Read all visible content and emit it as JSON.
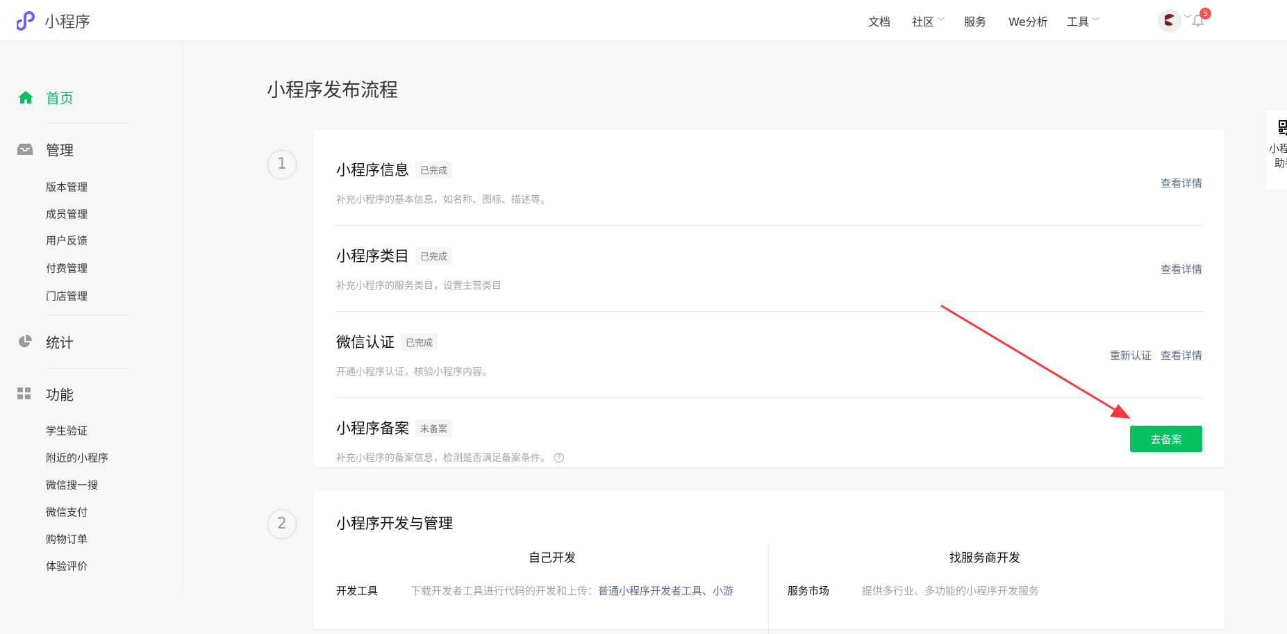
{
  "header": {
    "app_name": "小程序",
    "nav": [
      {
        "label": "文档"
      },
      {
        "label": "社区",
        "dropdown": true
      },
      {
        "label": "服务"
      },
      {
        "label": "We分析"
      },
      {
        "label": "工具",
        "dropdown": true
      }
    ],
    "notification_count": "5"
  },
  "sidebar": {
    "home": "首页",
    "manage": {
      "label": "管理",
      "items": [
        "版本管理",
        "成员管理",
        "用户反馈",
        "付费管理",
        "门店管理"
      ]
    },
    "stats": "统计",
    "features": {
      "label": "功能",
      "items": [
        "学生验证",
        "附近的小程序",
        "微信搜一搜",
        "微信支付",
        "购物订单",
        "体验评价"
      ]
    }
  },
  "main": {
    "title": "小程序发布流程",
    "step1": {
      "number": "1",
      "items": [
        {
          "title": "小程序信息",
          "status": "已完成",
          "desc": "补充小程序的基本信息，如名称、图标、描述等。",
          "links": [
            "查看详情"
          ]
        },
        {
          "title": "小程序类目",
          "status": "已完成",
          "desc": "补充小程序的服务类目，设置主营类目",
          "links": [
            "查看详情"
          ]
        },
        {
          "title": "微信认证",
          "status": "已完成",
          "desc": "开通小程序认证，核验小程序内容。",
          "links": [
            "重新认证",
            "查看详情"
          ]
        },
        {
          "title": "小程序备案",
          "status": "未备案",
          "desc": "补充小程序的备案信息，检测是否满足备案条件。",
          "button": "去备案"
        }
      ]
    },
    "step2": {
      "number": "2",
      "title": "小程序开发与管理",
      "columns": [
        {
          "header": "自己开发",
          "row_label": "开发工具",
          "row_text": "下载开发者工具进行代码的开发和上传：",
          "row_link": "普通小程序开发者工具、小游"
        },
        {
          "header": "找服务商开发",
          "row_label": "服务市场",
          "row_text": "提供多行业、多功能的小程序开发服务"
        }
      ]
    }
  },
  "float_panel": {
    "line1": "小程序",
    "line2": "助手"
  },
  "colors": {
    "accent": "#07c160",
    "link": "#576b95",
    "badge": "#fa5151",
    "logo": "#6467f0",
    "annotation_arrow": "#f33a3a"
  }
}
